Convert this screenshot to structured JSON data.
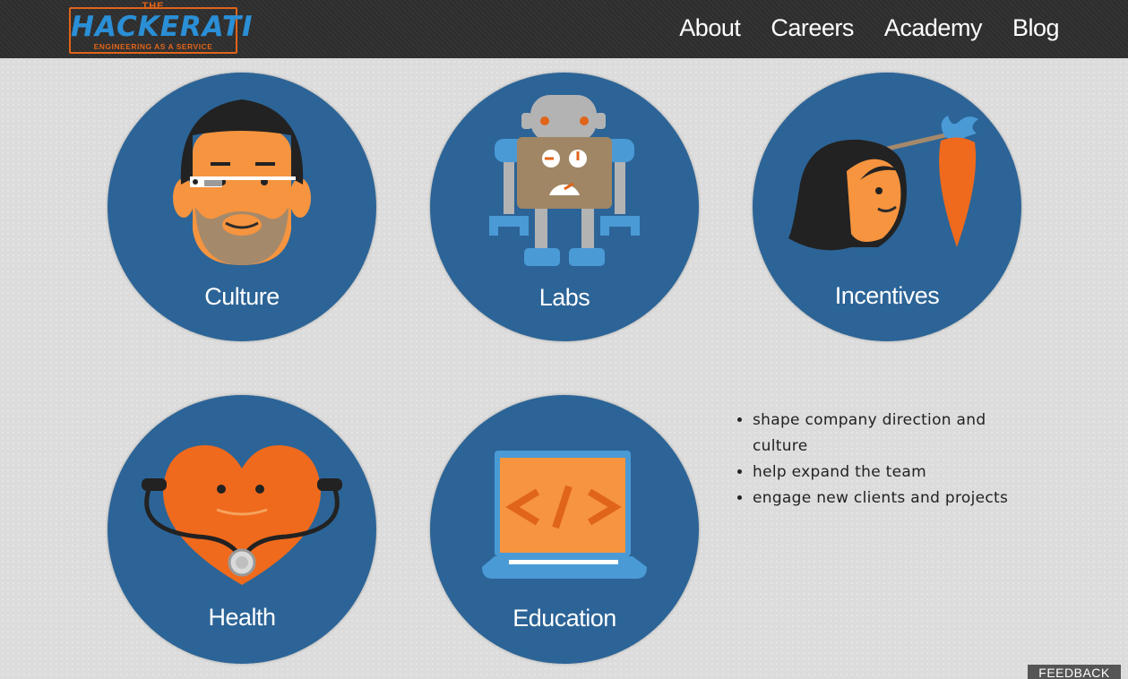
{
  "header": {
    "logo": {
      "the": "THE",
      "name": "HACKERATI",
      "tagline": "ENGINEERING AS A SERVICE"
    },
    "nav": [
      {
        "label": "About"
      },
      {
        "label": "Careers"
      },
      {
        "label": "Academy"
      },
      {
        "label": "Blog"
      }
    ]
  },
  "tiles": [
    {
      "label": "Culture",
      "icon": "glasses-man-icon"
    },
    {
      "label": "Labs",
      "icon": "robot-icon"
    },
    {
      "label": "Incentives",
      "icon": "carrot-icon"
    },
    {
      "label": "Health",
      "icon": "heart-stethoscope-icon"
    },
    {
      "label": "Education",
      "icon": "laptop-code-icon"
    }
  ],
  "bullets": [
    "shape company direction and culture",
    "help expand the team",
    "engage new clients and projects"
  ],
  "feedback": {
    "label": "FEEDBACK"
  },
  "colors": {
    "topbar": "#2d2d2d",
    "circle": "#2c6497",
    "orange": "#e0641a",
    "blue_accent": "#2a8fd6",
    "page_bg": "#dcdcdc"
  }
}
